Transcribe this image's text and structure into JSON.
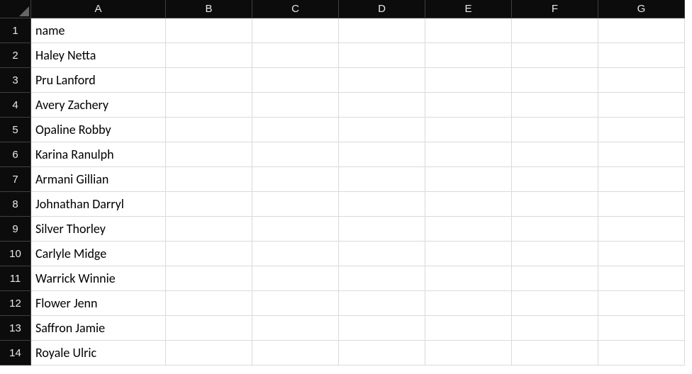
{
  "columns": [
    "A",
    "B",
    "C",
    "D",
    "E",
    "F",
    "G"
  ],
  "row_numbers": [
    1,
    2,
    3,
    4,
    5,
    6,
    7,
    8,
    9,
    10,
    11,
    12,
    13,
    14
  ],
  "cells": {
    "A1": "name",
    "A2": "Haley Netta",
    "A3": "Pru Lanford",
    "A4": "Avery Zachery",
    "A5": "Opaline Robby",
    "A6": "Karina Ranulph",
    "A7": "Armani Gillian",
    "A8": "Johnathan Darryl",
    "A9": "Silver Thorley",
    "A10": "Carlyle Midge",
    "A11": "Warrick Winnie",
    "A12": "Flower Jenn",
    "A13": "Saffron Jamie",
    "A14": "Royale Ulric"
  }
}
